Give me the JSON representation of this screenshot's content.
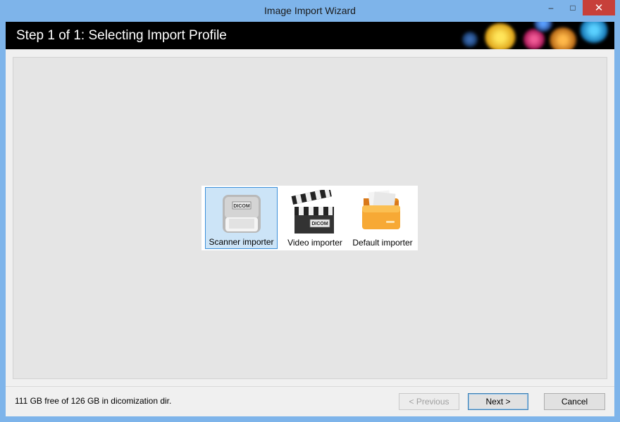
{
  "window": {
    "title": "Image Import Wizard",
    "controls": {
      "minimize": "–",
      "maximize": "□",
      "close": "✕"
    }
  },
  "header": {
    "title": "Step 1 of 1: Selecting Import Profile"
  },
  "profiles": [
    {
      "label": "Scanner importer",
      "icon": "scanner-icon",
      "badge": "DICOM",
      "selected": true
    },
    {
      "label": "Video importer",
      "icon": "clapperboard-icon",
      "badge": "DICOM",
      "selected": false
    },
    {
      "label": "Default importer",
      "icon": "folder-icon",
      "selected": false
    }
  ],
  "footer": {
    "status": "111 GB free of 126 GB in dicomization dir.",
    "previous_label": "< Previous",
    "next_label": "Next >",
    "cancel_label": "Cancel"
  },
  "colors": {
    "titlebar": "#7eb4ea",
    "close": "#c7403a",
    "selection": "#cce4f7",
    "folder": "#f5a623"
  }
}
